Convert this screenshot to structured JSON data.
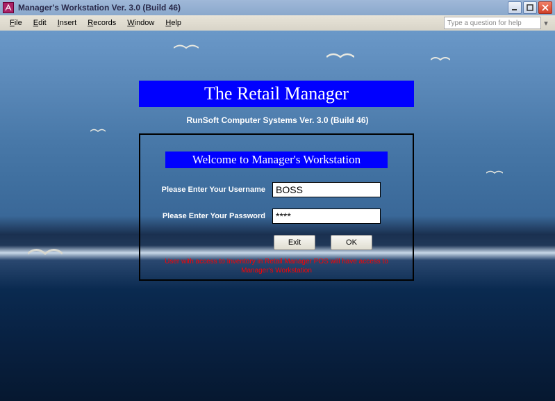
{
  "window": {
    "title": "Manager's Workstation    Ver. 3.0 (Build 46)"
  },
  "menu": {
    "file": "File",
    "edit": "Edit",
    "insert": "Insert",
    "records": "Records",
    "window": "Window",
    "help": "Help",
    "help_placeholder": "Type a question for help"
  },
  "header": {
    "title": "The Retail Manager",
    "subtitle": "RunSoft Computer Systems Ver. 3.0 (Build 46)"
  },
  "login": {
    "welcome": "Welcome to Manager's Workstation",
    "username_label": "Please Enter Your Username",
    "password_label": "Please Enter Your Password",
    "username_value": "BOSS",
    "password_value": "****",
    "exit_label": "Exit",
    "ok_label": "OK",
    "note_line1": "User with access to Inventory in Retail Manager POS will have access to",
    "note_line2": "Manager's Workstation"
  }
}
